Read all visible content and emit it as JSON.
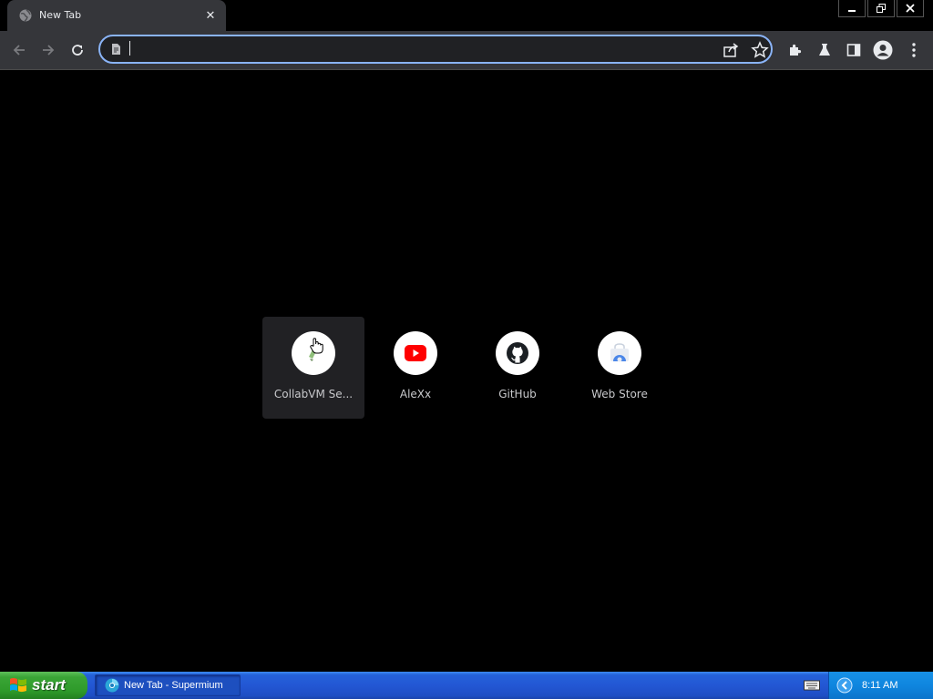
{
  "tab": {
    "title": "New Tab",
    "favicon": "globe-icon",
    "close_glyph": "✕"
  },
  "window_controls": {
    "minimize": "minimize-icon",
    "restore": "restore-icon",
    "close": "close-icon"
  },
  "toolbar": {
    "back": "arrow-left-icon",
    "forward": "arrow-right-icon",
    "reload": "reload-icon",
    "extensions": "puzzle-icon",
    "labs": "flask-icon",
    "side_panel": "side-panel-icon",
    "profile": "avatar-icon",
    "menu": "kebab-menu-icon"
  },
  "omnibox": {
    "value": "",
    "site_icon": "page-icon",
    "share": "share-icon",
    "bookmark": "star-icon"
  },
  "shortcuts": [
    {
      "label": "CollabVM Se...",
      "icon": "collabvm-icon",
      "hovered": true
    },
    {
      "label": "AleXx",
      "icon": "youtube-icon",
      "hovered": false
    },
    {
      "label": "GitHub",
      "icon": "github-icon",
      "hovered": false
    },
    {
      "label": "Web Store",
      "icon": "webstore-icon",
      "hovered": false
    }
  ],
  "taskbar": {
    "start_label": "start",
    "task_item": "New Tab - Supermium",
    "clock": "8:11 AM"
  },
  "colors": {
    "accent": "#8ab4f8",
    "toolbar": "#35363a",
    "youtube": "#ff0000",
    "taskbar": "#2357d4",
    "start": "#3aa536"
  }
}
